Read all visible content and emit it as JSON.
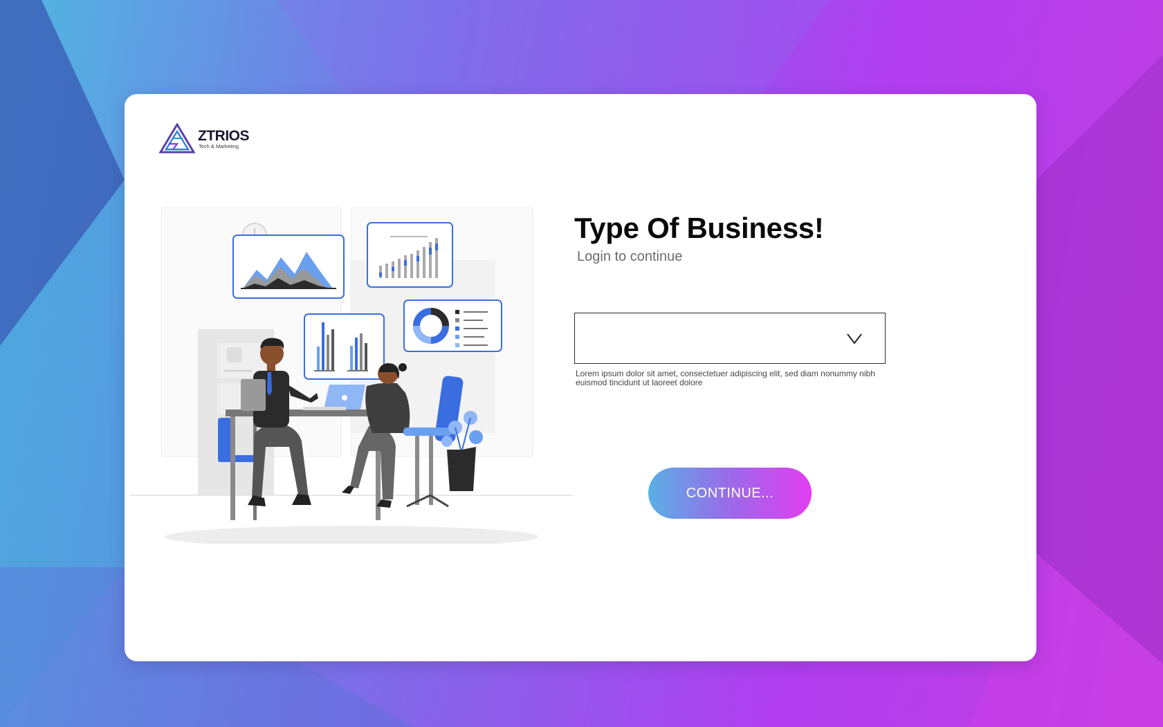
{
  "theme": {
    "accent_blue": "#3a6de0",
    "gradient_start": "#5aafe6",
    "gradient_end": "#e33df2",
    "card_background": "#ffffff"
  },
  "brand": {
    "name": "ZTRIOS",
    "tagline": "Tech & Marketing",
    "icon": "triangle-logo-icon"
  },
  "illustration": {
    "subject": "business-meeting-illustration",
    "icons": [
      "mountain-chart-icon",
      "bar-chart-icon",
      "donut-chart-icon",
      "clock-icon",
      "laptop-icon",
      "plant-icon"
    ]
  },
  "form": {
    "title": "Type Of Business!",
    "subtitle": "Login to continue",
    "select": {
      "selected_value": "",
      "icon": "chevron-down-icon"
    },
    "helper_text": "Lorem ipsum dolor sit amet, consectetuer adipiscing elit, sed diam nonummy nibh euismod tincidunt ut laoreet dolore",
    "continue_label": "CONTINUE..."
  }
}
